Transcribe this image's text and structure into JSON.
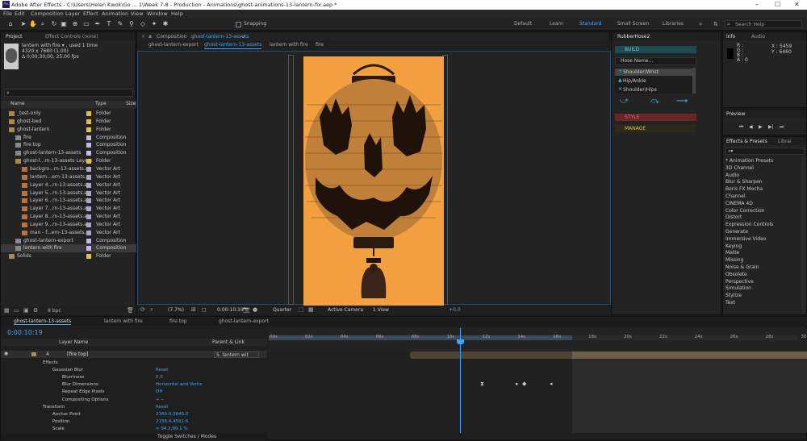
{
  "app": {
    "title": "Adobe After Effects - C:\\Users\\Helen Kwok\\Go ... 1\\Week 7-8 - Production - Animations\\ghost-animations-13-lantern-fix.aep *",
    "colors": {
      "accent": "#4aa3ff",
      "comp_bg": "#f2a040",
      "teal": "#1f4a52",
      "red": "#6a2626",
      "yellow_strip": "#2e2a18",
      "work_area": "#6e5f48"
    }
  },
  "menu": [
    "File",
    "Edit",
    "Composition",
    "Layer",
    "Effect",
    "Animation",
    "View",
    "Window",
    "Help"
  ],
  "toolbar": {
    "snapping": "Snapping",
    "workspaces": [
      "Default",
      "Learn",
      "Standard",
      "Small Screen",
      "Libraries"
    ],
    "active_workspace": "Standard",
    "search_placeholder": "Search Help"
  },
  "project": {
    "tab_project": "Project",
    "tab_effect_controls": "Effect Controls (none)",
    "item_name": "lantern with fire ▾ , used 1 time",
    "item_dims": "4320 x 7680 (1.00)",
    "item_dur": "Δ 0;00;30;00, 25.00 fps",
    "search_icon_label": "⌕",
    "col_name": "Name",
    "col_type": "Type",
    "col_size": "Size",
    "items": [
      {
        "name": "_test-only",
        "type": "Folder",
        "indent": 0,
        "kind": "folder",
        "color": "#e0c040"
      },
      {
        "name": "ghost-bed",
        "type": "Folder",
        "indent": 0,
        "kind": "folder",
        "color": "#e0c040"
      },
      {
        "name": "ghost-lantern",
        "type": "Folder",
        "indent": 0,
        "kind": "folder",
        "color": "#e0c040"
      },
      {
        "name": "fire",
        "type": "Composition",
        "indent": 1,
        "kind": "comp",
        "color": "#c8b8e8"
      },
      {
        "name": "fire top",
        "type": "Composition",
        "indent": 1,
        "kind": "comp",
        "color": "#c8b8e8"
      },
      {
        "name": "ghost-lantern-13-assets",
        "type": "Composition",
        "indent": 1,
        "kind": "comp",
        "color": "#c8b8e8"
      },
      {
        "name": "ghost-l...rn-13-assets Layers",
        "type": "Folder",
        "indent": 1,
        "kind": "folder",
        "color": "#e0c040"
      },
      {
        "name": "backgro...rn-13-assets.ai",
        "type": "Vector Art",
        "indent": 2,
        "kind": "ai",
        "color": "#a8a8c8"
      },
      {
        "name": "lantern...ern-13-assets.ai",
        "type": "Vector Art",
        "indent": 2,
        "kind": "ai",
        "color": "#a8a8c8"
      },
      {
        "name": "Layer 4...rn-13-assets.ai",
        "type": "Vector Art",
        "indent": 2,
        "kind": "ai",
        "color": "#a8a8c8"
      },
      {
        "name": "Layer 5...rn-13-assets.ai",
        "type": "Vector Art",
        "indent": 2,
        "kind": "ai",
        "color": "#a8a8c8"
      },
      {
        "name": "Layer 6...rn-13-assets.ai",
        "type": "Vector Art",
        "indent": 2,
        "kind": "ai",
        "color": "#a8a8c8"
      },
      {
        "name": "Layer 7...rn-13-assets.ai",
        "type": "Vector Art",
        "indent": 2,
        "kind": "ai",
        "color": "#a8a8c8"
      },
      {
        "name": "Layer 8...rn-13-assets.ai",
        "type": "Vector Art",
        "indent": 2,
        "kind": "ai",
        "color": "#a8a8c8"
      },
      {
        "name": "Layer 9...rn-13-assets.ai",
        "type": "Vector Art",
        "indent": 2,
        "kind": "ai",
        "color": "#a8a8c8"
      },
      {
        "name": "man - f...ern-13-assets.ai",
        "type": "Vector Art",
        "indent": 2,
        "kind": "ai",
        "color": "#a8a8c8"
      },
      {
        "name": "ghost-lantern-export",
        "type": "Composition",
        "indent": 1,
        "kind": "comp",
        "color": "#c8b8e8"
      },
      {
        "name": "lantern with fire",
        "type": "Composition",
        "indent": 1,
        "kind": "comp",
        "color": "#c8b8e8",
        "selected": true
      },
      {
        "name": "Solids",
        "type": "Folder",
        "indent": 0,
        "kind": "folder",
        "color": "#e0c040"
      }
    ],
    "bpc": "8 bpc"
  },
  "composition": {
    "tab_label": "Composition",
    "comp_name": "ghost-lantern-13-assets",
    "breadcrumbs": [
      "ghost-lantern-export",
      "ghost-lantern-13-assets",
      "lantern with fire",
      "fire"
    ],
    "zoom": "(7.7%)",
    "timecode": "0:00:10:19",
    "quality": "Quarter",
    "camera": "Active Camera",
    "view": "1 View",
    "exposure": "+0.0"
  },
  "rubberhose": {
    "title": "RubberHose2",
    "build": "BUILD",
    "hose_name": "Hose Name...",
    "list": [
      "Shoulder/Wrist",
      "Hip/Ankle",
      "Shoulder/Hips"
    ],
    "style": "STYLE",
    "manage": "MANAGE"
  },
  "info": {
    "tab_info": "Info",
    "tab_audio": "Audio",
    "r": "R :",
    "g": "G :",
    "b": "B :",
    "a": "A : 0",
    "x": "X : 5459",
    "y": "Y : 6460"
  },
  "preview": {
    "title": "Preview"
  },
  "effects": {
    "tab": "Effects & Presets",
    "tab2": "Librai",
    "search": "⌕▾",
    "items": [
      "* Animation Presets",
      "3D Channel",
      "Audio",
      "Blur & Sharpen",
      "Boris FX Mocha",
      "Channel",
      "CINEMA 4D",
      "Color Correction",
      "Distort",
      "Expression Controls",
      "Generate",
      "Immersive Video",
      "Keying",
      "Matte",
      "Missing",
      "Noise & Grain",
      "Obsolete",
      "Perspective",
      "Simulation",
      "Stylize",
      "Text"
    ]
  },
  "timeline": {
    "tabs": [
      "ghost-lantern-13-assets",
      "lantern with fire",
      "fire top",
      "ghost-lantern-export"
    ],
    "timecode": "0:00:10:19",
    "col_layer_name": "Layer Name",
    "col_parent": "Parent & Link",
    "layer_num": "4",
    "layer_name": "[fire top]",
    "parent": "5. lantern wit",
    "props": [
      {
        "label": "Effects",
        "indent": 1,
        "value": ""
      },
      {
        "label": "Gaussian Blur",
        "indent": 2,
        "value": "Reset"
      },
      {
        "label": "Blurriness",
        "indent": 3,
        "value": "0.0"
      },
      {
        "label": "Blur Dimensions",
        "indent": 3,
        "value": "Horizontal and Vertic"
      },
      {
        "label": "Repeat Edge Pixels",
        "indent": 3,
        "value": "Off"
      },
      {
        "label": "Compositing Options",
        "indent": 3,
        "value": "+ ─"
      },
      {
        "label": "Transform",
        "indent": 1,
        "value": "Reset"
      },
      {
        "label": "Anchor Point",
        "indent": 2,
        "value": "2160.0,3840.0"
      },
      {
        "label": "Position",
        "indent": 2,
        "value": "2158.4,4591.6"
      },
      {
        "label": "Scale",
        "indent": 2,
        "value": "∞ 94.2,99.1 %"
      }
    ],
    "ruler": [
      "00s",
      "02s",
      "04s",
      "06s",
      "08s",
      "10s",
      "12s",
      "14s",
      "16s",
      "18s",
      "20s",
      "22s",
      "24s",
      "26s",
      "28s",
      "30"
    ],
    "toggle_label": "Toggle Switches / Modes"
  }
}
